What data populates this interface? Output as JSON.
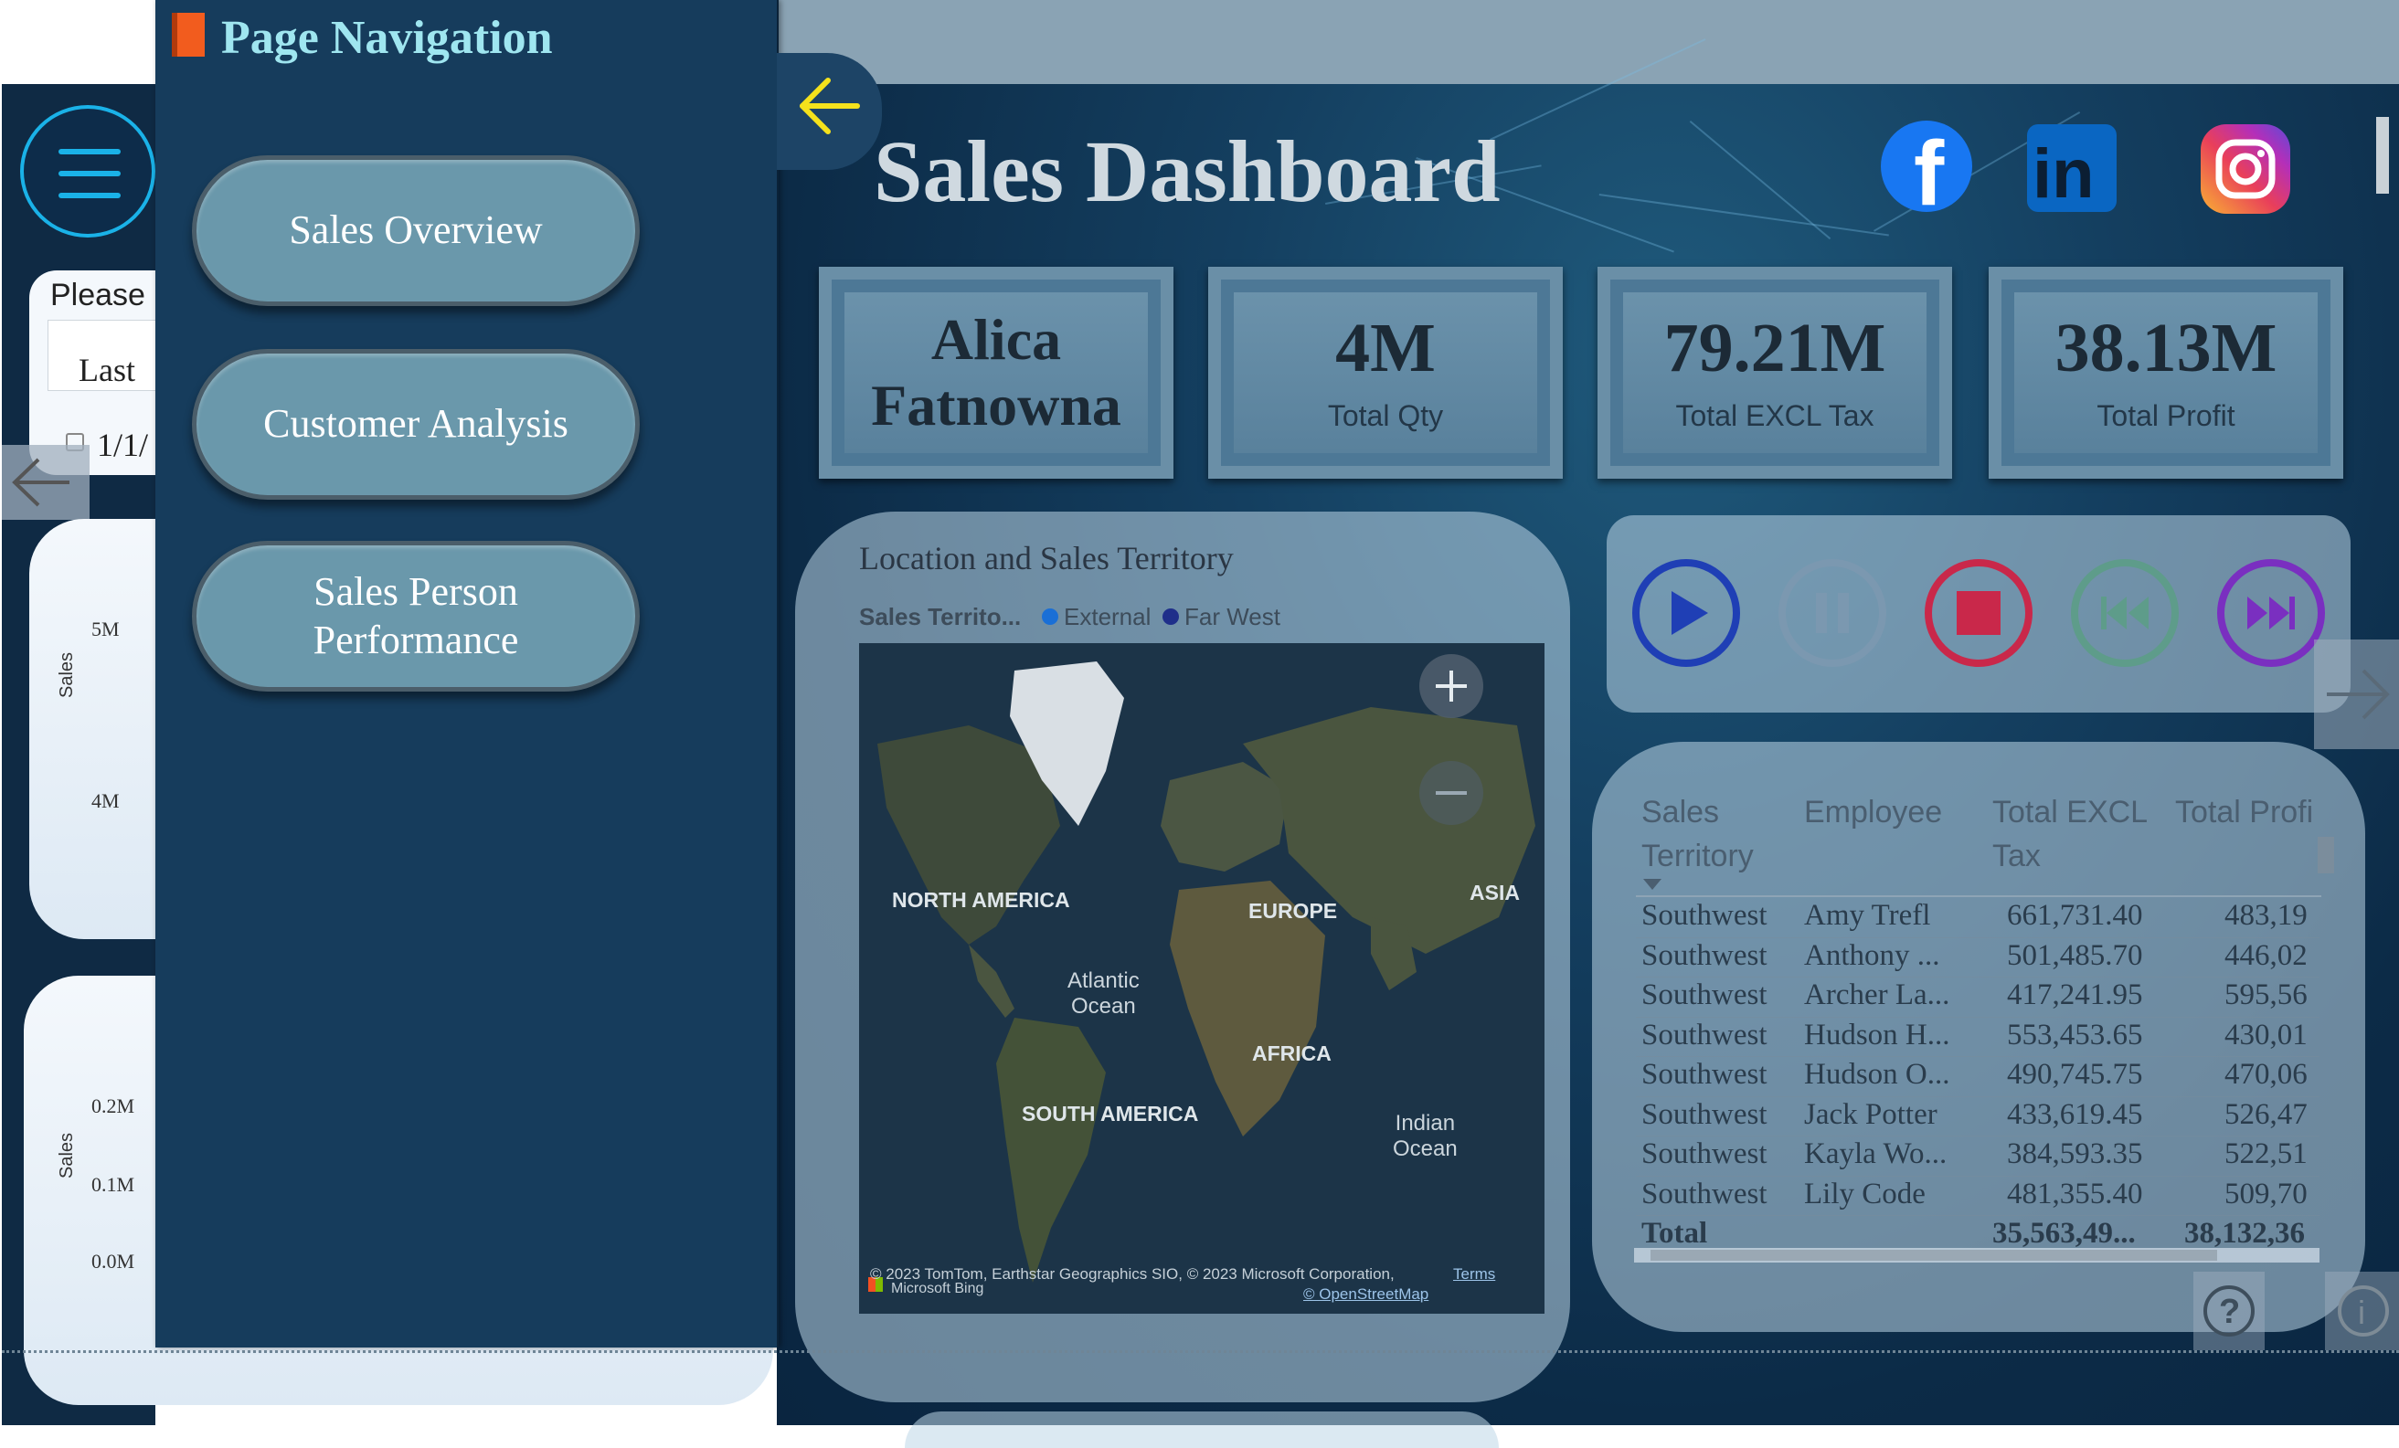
{
  "nav": {
    "title": "Page Navigation",
    "buttons": [
      "Sales Overview",
      "Customer Analysis",
      "Sales Person Performance"
    ]
  },
  "left_page": {
    "please_label": "Please",
    "filter_value": "Last",
    "date_value": "1/1/",
    "chart1": {
      "ylabel": "Sales",
      "ticks": [
        "5M",
        "4M"
      ]
    },
    "chart2": {
      "ylabel": "Sales",
      "ticks": [
        "0.2M",
        "0.1M",
        "0.0M"
      ]
    }
  },
  "dashboard": {
    "title": "Sales Dashboard",
    "social_icons": [
      "facebook-icon",
      "linkedin-icon",
      "instagram-icon"
    ],
    "kpis": [
      {
        "value": "Alica Fatnowna",
        "label": ""
      },
      {
        "value": "4M",
        "label": "Total Qty"
      },
      {
        "value": "79.21M",
        "label": "Total EXCL Tax"
      },
      {
        "value": "38.13M",
        "label": "Total Profit"
      }
    ],
    "map": {
      "title": "Location and Sales Territory",
      "legend_title": "Sales Territo...",
      "legend": [
        {
          "name": "External",
          "color": "#1a6fd6"
        },
        {
          "name": "Far West",
          "color": "#1f2f8a"
        }
      ],
      "labels": {
        "north_america": "NORTH AMERICA",
        "europe": "EUROPE",
        "asia": "ASIA",
        "atlantic": "Atlantic\nOcean",
        "africa": "AFRICA",
        "south_america": "SOUTH AMERICA",
        "indian": "Indian\nOcean"
      },
      "attribution": "© 2023 TomTom, Earthstar Geographics SIO, © 2023 Microsoft Corporation,",
      "terms": "Terms",
      "bing": "Microsoft Bing",
      "osm": "© OpenStreetMap"
    },
    "media_controls": [
      "play",
      "pause",
      "stop",
      "previous",
      "next"
    ],
    "table": {
      "headers": [
        "Sales Territory",
        "Employee",
        "Total EXCL Tax",
        "Total Profi"
      ],
      "rows": [
        [
          "Southwest",
          "Amy Trefl",
          "661,731.40",
          "483,19"
        ],
        [
          "Southwest",
          "Anthony ...",
          "501,485.70",
          "446,02"
        ],
        [
          "Southwest",
          "Archer La...",
          "417,241.95",
          "595,56"
        ],
        [
          "Southwest",
          "Hudson H...",
          "553,453.65",
          "430,01"
        ],
        [
          "Southwest",
          "Hudson O...",
          "490,745.75",
          "470,06"
        ],
        [
          "Southwest",
          "Jack Potter",
          "433,619.45",
          "526,47"
        ],
        [
          "Southwest",
          "Kayla Wo...",
          "384,593.35",
          "522,51"
        ],
        [
          "Southwest",
          "Lily Code",
          "481,355.40",
          "509,70"
        ]
      ],
      "total": [
        "Total",
        "35,563,49...",
        "38,132,36"
      ]
    }
  }
}
